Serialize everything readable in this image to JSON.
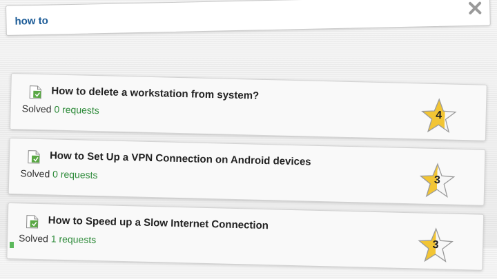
{
  "search": {
    "value": "how to"
  },
  "results": [
    {
      "title": "How to delete a workstation from system?",
      "status_label": "Solved",
      "requests_text": "0 requests",
      "rating": "4"
    },
    {
      "title": "How to Set Up a VPN Connection on Android devices",
      "status_label": "Solved",
      "requests_text": "0 requests",
      "rating": "3"
    },
    {
      "title": "How to Speed up a Slow Internet Connection",
      "status_label": "Solved",
      "requests_text": "1 requests",
      "rating": "3"
    }
  ],
  "colors": {
    "search_text": "#1a5a96",
    "requests_link": "#2e8b3a",
    "star_gold": "#f2c534"
  },
  "icons": {
    "doc": "document-icon",
    "clear": "close-icon",
    "star": "star-rating-icon"
  }
}
